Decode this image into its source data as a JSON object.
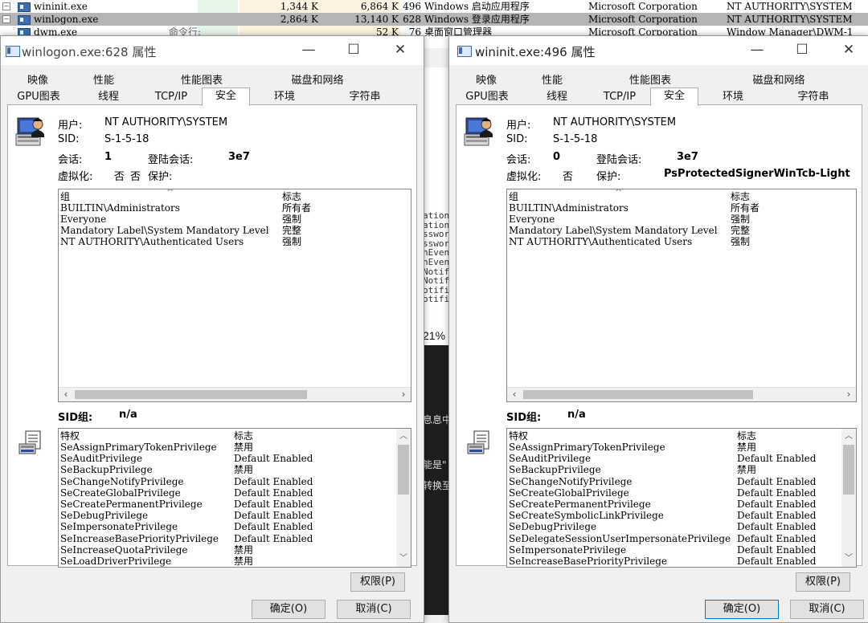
{
  "background": {
    "processes": [
      {
        "name": "wininit.exe",
        "expander": "−",
        "cpu": "",
        "private_bytes": "1,344 K",
        "working_set": "6,864 K",
        "pid": "496",
        "description": "Windows 启动应用程序",
        "company": "Microsoft Corporation",
        "user": "NT AUTHORITY\\SYSTEM",
        "selected": false
      },
      {
        "name": "winlogon.exe",
        "expander": "−",
        "cpu": "",
        "private_bytes": "2,864 K",
        "working_set": "13,140 K",
        "pid": "628",
        "description": "Windows 登录应用程序",
        "company": "Microsoft Corporation",
        "user": "NT AUTHORITY\\SYSTEM",
        "selected": true
      },
      {
        "name": "dwm.exe",
        "expander": "",
        "cpu": "命令行:",
        "private_bytes": "",
        "working_set": "52 K",
        "pid": "76",
        "description": "桌面窗口管理器",
        "company": "Microsoft Corporation",
        "user": "Window Manager\\DWM-1",
        "selected": false
      }
    ],
    "middle_fragments": [
      "ation",
      "ation",
      "sswor",
      "sswor",
      "nEven",
      "nEven",
      "Notif",
      "Notif",
      "otifi",
      "otifi"
    ],
    "middle_percent": "21%",
    "middle_dark_fragments": [
      "息息中",
      "能是\"",
      "转换至"
    ]
  },
  "left_dialog": {
    "title": "winlogon.exe:628 属性",
    "controls": {
      "minimize": "—",
      "maximize": "☐",
      "close": "✕"
    },
    "tabs_row1": [
      "映像",
      "性能",
      "性能图表",
      "磁盘和网络"
    ],
    "tabs_row2": [
      "GPU图表",
      "线程",
      "TCP/IP",
      "安全",
      "环境",
      "字符串"
    ],
    "active_tab": "安全",
    "user_label": "用户:",
    "user_value": "NT AUTHORITY\\SYSTEM",
    "sid_label": "SID:",
    "sid_value": "S-1-5-18",
    "session_label": "会话:",
    "session_value": "1",
    "logon_session_label": "登陆会话:",
    "logon_session_value": "3e7",
    "virtualized_label": "虚拟化:",
    "virtualized_value": "否",
    "protected_label": "保护:",
    "protected_value": "否",
    "groups_header": {
      "group": "组",
      "flags": "标志"
    },
    "groups": [
      {
        "name": "BUILTIN\\Administrators",
        "flag": "所有者"
      },
      {
        "name": "Everyone",
        "flag": "强制"
      },
      {
        "name": "Mandatory Label\\System Mandatory Level",
        "flag": "完整"
      },
      {
        "name": "NT AUTHORITY\\Authenticated Users",
        "flag": "强制"
      }
    ],
    "sid_group_label": "SID组:",
    "sid_group_value": "n/a",
    "privileges_header": {
      "privilege": "特权",
      "flags": "标志"
    },
    "privileges": [
      {
        "name": "SeAssignPrimaryTokenPrivilege",
        "flag": "禁用"
      },
      {
        "name": "SeAuditPrivilege",
        "flag": "Default Enabled"
      },
      {
        "name": "SeBackupPrivilege",
        "flag": "禁用"
      },
      {
        "name": "SeChangeNotifyPrivilege",
        "flag": "Default Enabled"
      },
      {
        "name": "SeCreateGlobalPrivilege",
        "flag": "Default Enabled"
      },
      {
        "name": "SeCreatePermanentPrivilege",
        "flag": "Default Enabled"
      },
      {
        "name": "SeDebugPrivilege",
        "flag": "Default Enabled"
      },
      {
        "name": "SeImpersonatePrivilege",
        "flag": "Default Enabled"
      },
      {
        "name": "SeIncreaseBasePriorityPrivilege",
        "flag": "Default Enabled"
      },
      {
        "name": "SeIncreaseQuotaPrivilege",
        "flag": "禁用"
      },
      {
        "name": "SeLoadDriverPrivilege",
        "flag": "禁用"
      }
    ],
    "permissions_button": "权限(P)",
    "ok_button": "确定(O)",
    "cancel_button": "取消(C)"
  },
  "right_dialog": {
    "title": "wininit.exe:496 属性",
    "controls": {
      "minimize": "—",
      "maximize": "☐",
      "close": "✕"
    },
    "tabs_row1": [
      "映像",
      "性能",
      "性能图表",
      "磁盘和网络"
    ],
    "tabs_row2": [
      "GPU图表",
      "线程",
      "TCP/IP",
      "安全",
      "环境",
      "字符串"
    ],
    "active_tab": "安全",
    "user_label": "用户:",
    "user_value": "NT AUTHORITY\\SYSTEM",
    "sid_label": "SID:",
    "sid_value": "S-1-5-18",
    "session_label": "会话:",
    "session_value": "0",
    "logon_session_label": "登陆会话:",
    "logon_session_value": "3e7",
    "virtualized_label": "虚拟化:",
    "virtualized_value": "否",
    "protected_label": "保护:",
    "protected_value": "PsProtectedSignerWinTcb-Light",
    "groups_header": {
      "group": "组",
      "flags": "标志"
    },
    "groups": [
      {
        "name": "BUILTIN\\Administrators",
        "flag": "所有者"
      },
      {
        "name": "Everyone",
        "flag": "强制"
      },
      {
        "name": "Mandatory Label\\System Mandatory Level",
        "flag": "完整"
      },
      {
        "name": "NT AUTHORITY\\Authenticated Users",
        "flag": "强制"
      }
    ],
    "sid_group_label": "SID组:",
    "sid_group_value": "n/a",
    "privileges_header": {
      "privilege": "特权",
      "flags": "标志"
    },
    "privileges": [
      {
        "name": "SeAssignPrimaryTokenPrivilege",
        "flag": "禁用"
      },
      {
        "name": "SeAuditPrivilege",
        "flag": "Default Enabled"
      },
      {
        "name": "SeBackupPrivilege",
        "flag": "禁用"
      },
      {
        "name": "SeChangeNotifyPrivilege",
        "flag": "Default Enabled"
      },
      {
        "name": "SeCreateGlobalPrivilege",
        "flag": "Default Enabled"
      },
      {
        "name": "SeCreatePermanentPrivilege",
        "flag": "Default Enabled"
      },
      {
        "name": "SeCreateSymbolicLinkPrivilege",
        "flag": "Default Enabled"
      },
      {
        "name": "SeDebugPrivilege",
        "flag": "Default Enabled"
      },
      {
        "name": "SeDelegateSessionUserImpersonatePrivilege",
        "flag": "Default Enabled"
      },
      {
        "name": "SeImpersonatePrivilege",
        "flag": "Default Enabled"
      },
      {
        "name": "SeIncreaseBasePriorityPrivilege",
        "flag": "Default Enabled"
      }
    ],
    "permissions_button": "权限(P)",
    "ok_button": "确定(O)",
    "cancel_button": "取消(C)"
  }
}
